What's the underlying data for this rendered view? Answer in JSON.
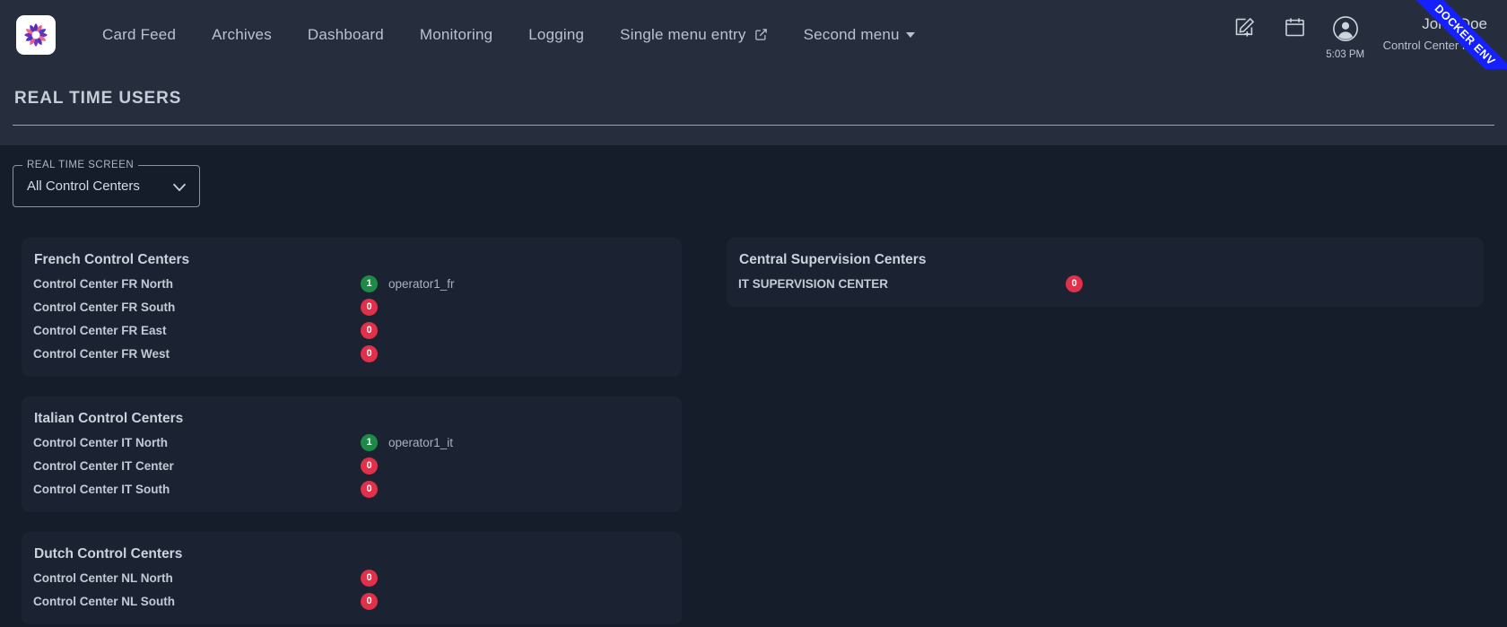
{
  "app": {
    "logo_icon": "flower-ring-logo-icon",
    "ribbon_label": "DOCKER ENV",
    "ribbon_color": "#1520ff"
  },
  "nav": {
    "items": [
      {
        "label": "Card Feed",
        "icon": "",
        "caret": false
      },
      {
        "label": "Archives",
        "icon": "",
        "caret": false
      },
      {
        "label": "Dashboard",
        "icon": "",
        "caret": false
      },
      {
        "label": "Monitoring",
        "icon": "",
        "caret": false
      },
      {
        "label": "Logging",
        "icon": "",
        "caret": false
      },
      {
        "label": "Single menu entry",
        "icon": "external-link-icon",
        "caret": false
      },
      {
        "label": "Second menu",
        "icon": "",
        "caret": true
      }
    ]
  },
  "toolbar_right": {
    "compose_icon": "compose-add-icon",
    "calendar_icon": "calendar-icon",
    "account_icon": "account-circle-icon",
    "time": "5:03 PM",
    "user_name": "John Doe",
    "user_center": "Control Center FR..."
  },
  "page": {
    "title": "REAL TIME USERS"
  },
  "filter": {
    "label": "REAL TIME SCREEN",
    "value": "All Control Centers",
    "arrow_icon": "chevron-down-icon",
    "options": [
      "All Control Centers"
    ]
  },
  "colors": {
    "badge_zero": "#e0304a",
    "badge_active": "#1f8a48",
    "appbar_bg": "#262e3d",
    "page_bg": "#161d2a",
    "card_bg": "#1b2231"
  },
  "groups_left": [
    {
      "title": "French Control Centers",
      "rows": [
        {
          "name": "Control Center FR North",
          "count": "1",
          "state": "active",
          "operator": "operator1_fr"
        },
        {
          "name": "Control Center FR South",
          "count": "0",
          "state": "zero",
          "operator": ""
        },
        {
          "name": "Control Center FR East",
          "count": "0",
          "state": "zero",
          "operator": ""
        },
        {
          "name": "Control Center FR West",
          "count": "0",
          "state": "zero",
          "operator": ""
        }
      ]
    },
    {
      "title": "Italian Control Centers",
      "rows": [
        {
          "name": "Control Center IT North",
          "count": "1",
          "state": "active",
          "operator": "operator1_it"
        },
        {
          "name": "Control Center IT Center",
          "count": "0",
          "state": "zero",
          "operator": ""
        },
        {
          "name": "Control Center IT South",
          "count": "0",
          "state": "zero",
          "operator": ""
        }
      ]
    },
    {
      "title": "Dutch Control Centers",
      "rows": [
        {
          "name": "Control Center NL North",
          "count": "0",
          "state": "zero",
          "operator": ""
        },
        {
          "name": "Control Center NL South",
          "count": "0",
          "state": "zero",
          "operator": ""
        }
      ]
    }
  ],
  "groups_right": [
    {
      "title": "Central Supervision Centers",
      "rows": [
        {
          "name": "IT SUPERVISION CENTER",
          "count": "0",
          "state": "zero",
          "operator": ""
        }
      ]
    }
  ]
}
